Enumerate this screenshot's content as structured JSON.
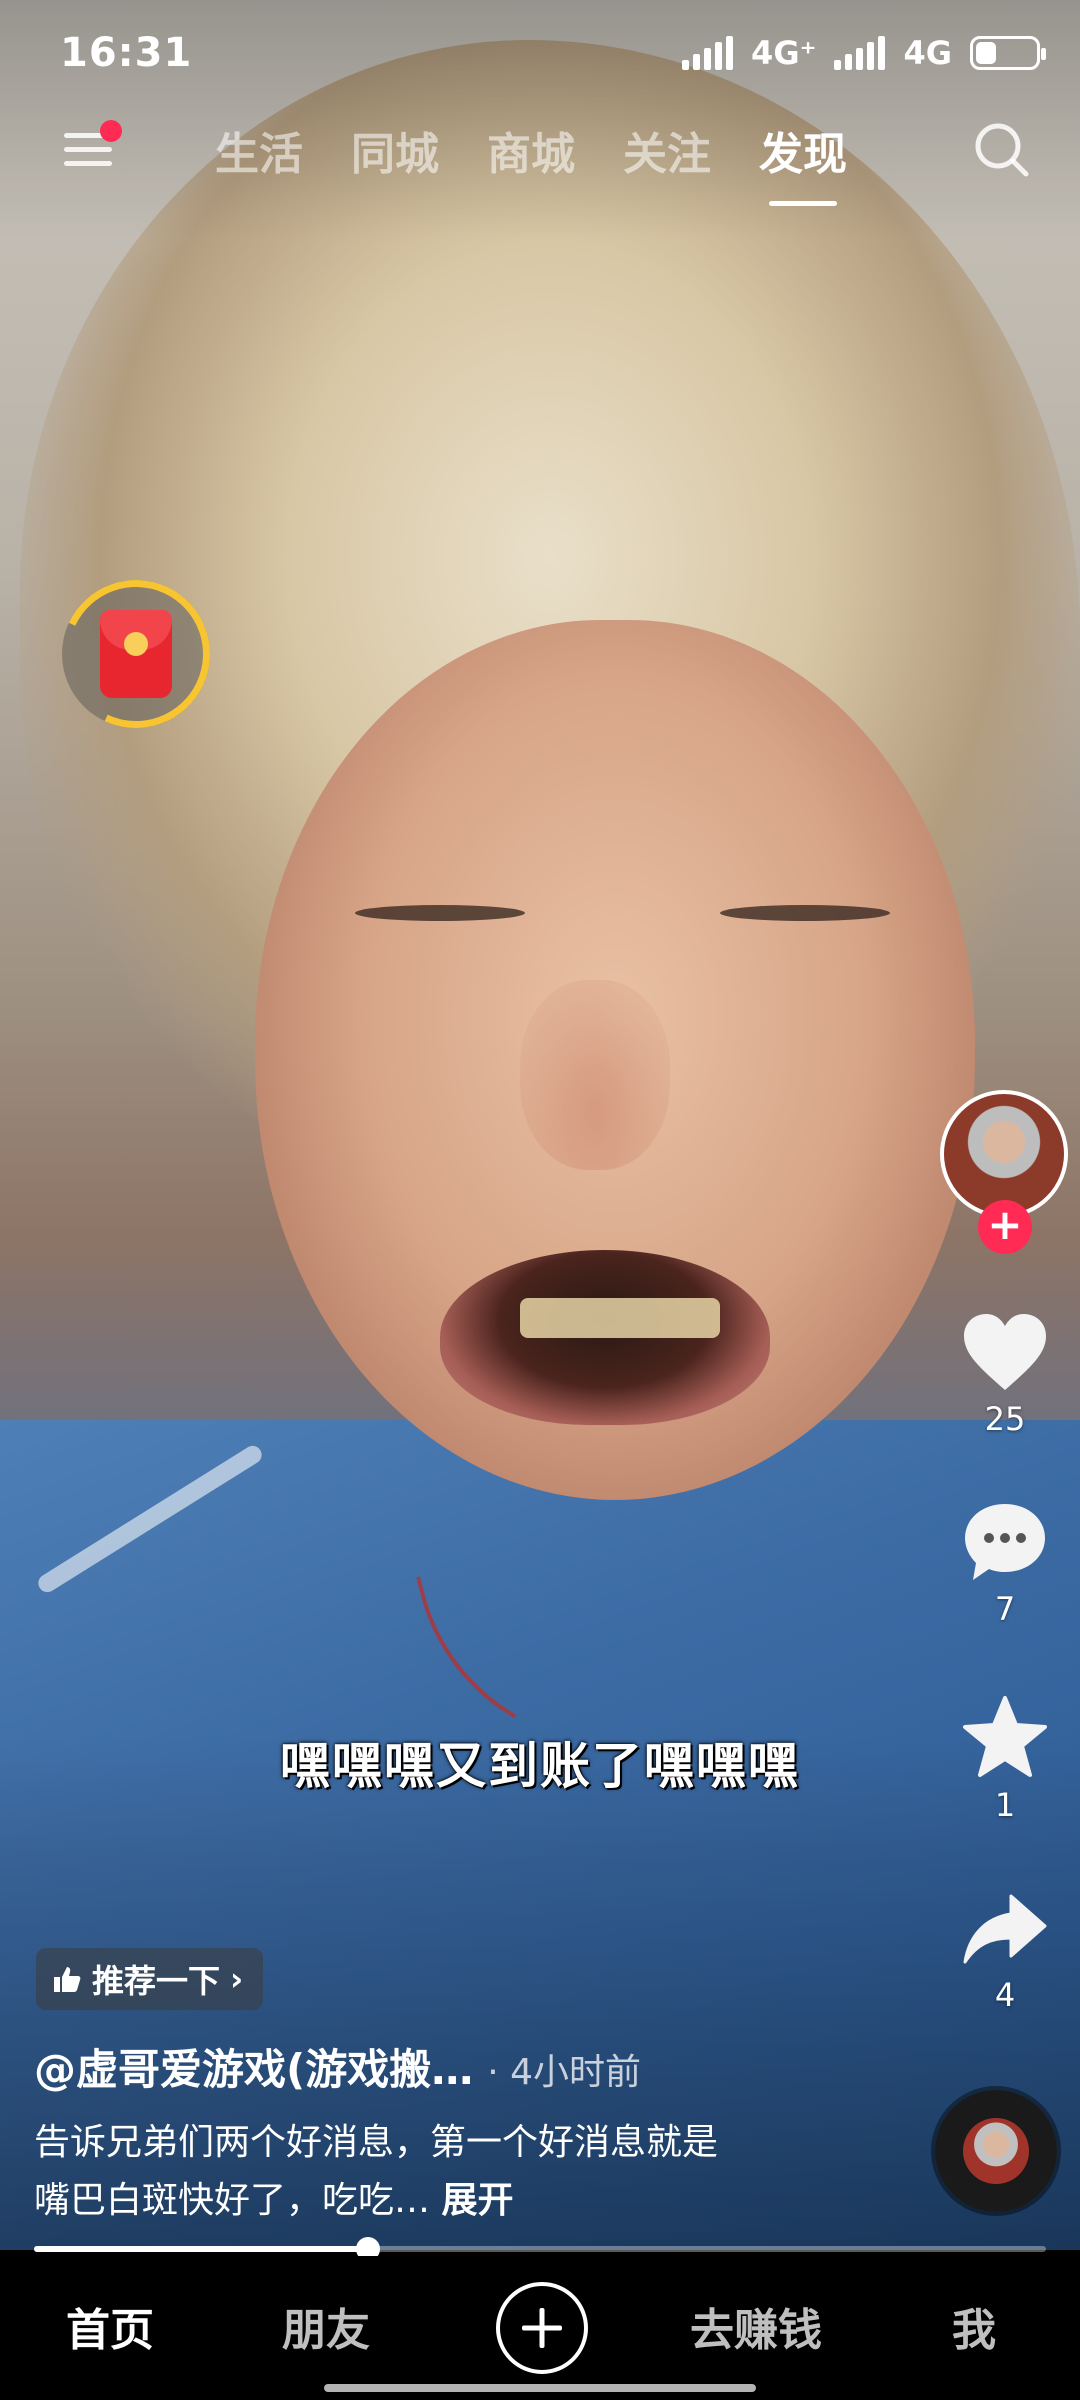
{
  "status_bar": {
    "time": "16:31",
    "network_1": "4G⁺",
    "network_2": "4G",
    "battery_level": 0.35
  },
  "top_nav": {
    "tabs": [
      {
        "label": "生活",
        "active": false
      },
      {
        "label": "同城",
        "active": false
      },
      {
        "label": "商城",
        "active": false
      },
      {
        "label": "关注",
        "active": false
      },
      {
        "label": "发现",
        "active": true
      }
    ],
    "menu_icon": "hamburger-menu-icon",
    "search_icon": "search-icon"
  },
  "video": {
    "subtitle": "嘿嘿嘿又到账了嘿嘿嘿",
    "recommend_label": "推荐一下",
    "author": "@虚哥爱游戏(游戏搬…",
    "time_ago": "· 4小时前",
    "description": "告诉兄弟们两个好消息，第一个好消息就是嘴巴白斑快好了，吃吃…",
    "expand_label": "展开",
    "progress": 0.33
  },
  "rail": {
    "likes": "25",
    "comments": "7",
    "favorites": "1",
    "shares": "4",
    "follow_label": "+"
  },
  "bottom_nav": {
    "items": [
      {
        "label": "首页",
        "active": true
      },
      {
        "label": "朋友",
        "active": false
      },
      {
        "label": "去赚钱",
        "active": false
      },
      {
        "label": "我",
        "active": false
      }
    ]
  },
  "colors": {
    "accent": "#ff2b54",
    "ring": "#f7c531",
    "packet": "#e8262f"
  }
}
